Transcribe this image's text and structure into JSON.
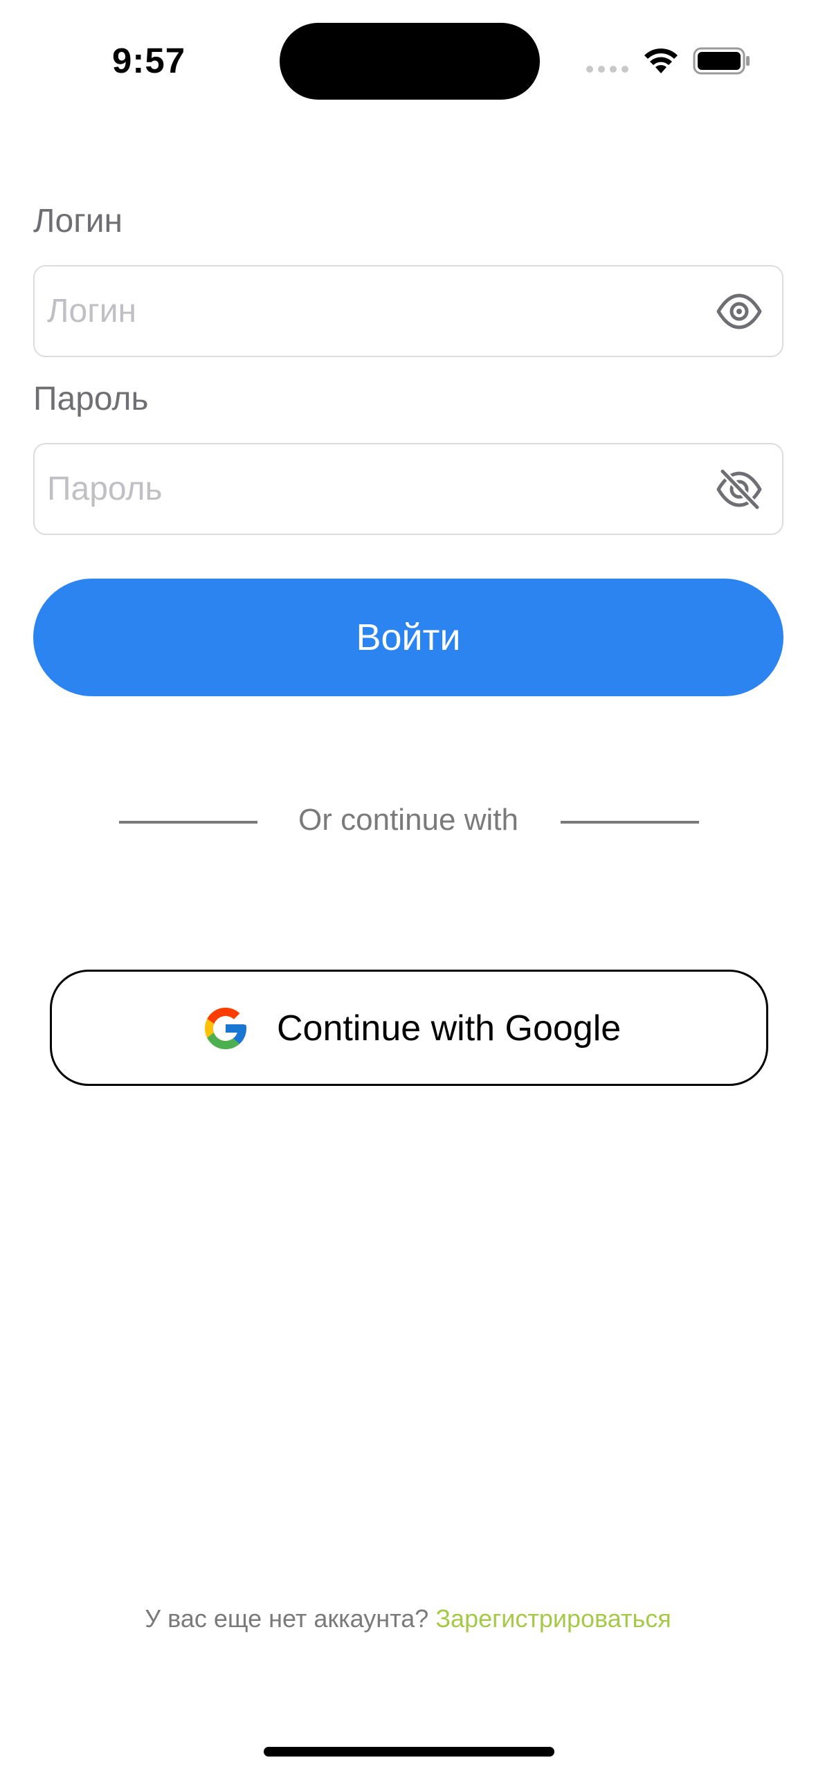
{
  "status_bar": {
    "time": "9:57"
  },
  "form": {
    "login": {
      "label": "Логин",
      "placeholder": "Логин",
      "value": "",
      "icon": "eye-icon"
    },
    "password": {
      "label": "Пароль",
      "placeholder": "Пароль",
      "value": "",
      "icon": "eye-slash-icon"
    },
    "submit_label": "Войти"
  },
  "divider": {
    "text": "Or continue with"
  },
  "google": {
    "label": "Continue with Google",
    "icon": "google-logo-icon"
  },
  "footer": {
    "question": "У вас еще нет аккаунта?",
    "link": "Зарегистрироваться"
  },
  "colors": {
    "primary": "#2b84f0",
    "link": "#a6c94a",
    "muted": "#7a7a7a"
  }
}
